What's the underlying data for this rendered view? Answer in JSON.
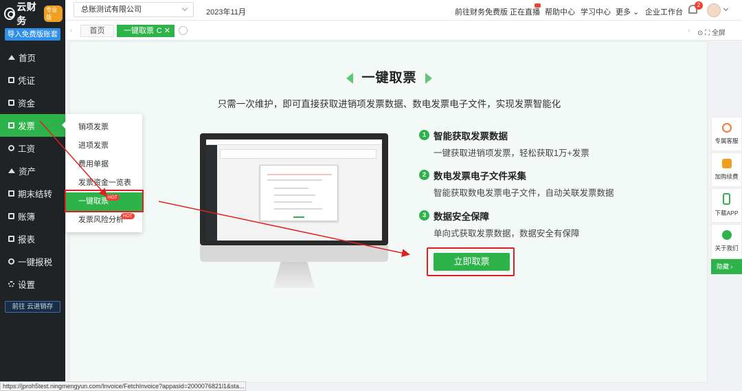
{
  "app": {
    "logo_text": "云财务",
    "edition_badge": "专业版",
    "import_button": "导入免费版账套",
    "yunjinxiao_link": "前往 云进销存"
  },
  "sidebar": {
    "items": [
      {
        "label": "首页",
        "icon": "home-icon"
      },
      {
        "label": "凭证",
        "icon": "voucher-icon"
      },
      {
        "label": "资金",
        "icon": "funds-icon"
      },
      {
        "label": "发票",
        "icon": "invoice-icon",
        "active": true
      },
      {
        "label": "工资",
        "icon": "salary-icon"
      },
      {
        "label": "资产",
        "icon": "assets-icon"
      },
      {
        "label": "期末结转",
        "icon": "period-end-icon"
      },
      {
        "label": "账簿",
        "icon": "ledger-icon"
      },
      {
        "label": "报表",
        "icon": "report-icon"
      },
      {
        "label": "一键报税",
        "icon": "tax-icon"
      },
      {
        "label": "设置",
        "icon": "gear-icon"
      }
    ]
  },
  "topbar": {
    "company": "总账测试有限公司",
    "period": "2023年11月",
    "links": [
      "前往财务免费版",
      "正在直播",
      "帮助中心",
      "学习中心",
      "更多",
      "企业工作台"
    ],
    "notification_count": "2"
  },
  "tabs": {
    "home": "首页",
    "current": "一键取票",
    "current_icons": "C ✕",
    "fullscreen": "全屏"
  },
  "submenu": {
    "items": [
      {
        "label": "销项发票"
      },
      {
        "label": "进项发票"
      },
      {
        "label": "费用单据"
      },
      {
        "label": "发票资金一览表"
      },
      {
        "label": "一键取票",
        "active": true,
        "badge": "HOT"
      },
      {
        "label": "发票风险分析",
        "badge": "HOT"
      }
    ]
  },
  "hero": {
    "title": "一键取票",
    "subtitle": "只需一次维护，即可直接获取进销项发票数据、数电发票电子文件，实现发票智能化"
  },
  "features": [
    {
      "num": "1",
      "title": "智能获取发票数据",
      "desc": "一键获取进销项发票，轻松获取1万+发票"
    },
    {
      "num": "2",
      "title": "数电发票电子文件采集",
      "desc": "智能获取数电发票电子文件，自动关联发票数据"
    },
    {
      "num": "3",
      "title": "数据安全保障",
      "desc": "单向式获取发票数据，数据安全有保障"
    }
  ],
  "cta": {
    "label": "立即取票"
  },
  "right_float": {
    "items": [
      {
        "label": "专属客服",
        "icon": "headset-icon",
        "color": "#f07a3a"
      },
      {
        "label": "加购续费",
        "icon": "yuan-icon",
        "color": "#f0a020"
      },
      {
        "label": "下载APP",
        "icon": "phone-icon",
        "color": "#2db34a"
      },
      {
        "label": "关于我们",
        "icon": "wechat-icon",
        "color": "#2db34a"
      }
    ],
    "hide_label": "隐藏 ›"
  },
  "statusbar": {
    "url": "https://jproh5test.ningmengyun.com/Invoice/FetchInvoice?appasid=2000076821l1&sta..."
  },
  "colors": {
    "accent": "#2db34a",
    "sidebar_bg": "#1f2326",
    "highlight": "#e02020"
  }
}
